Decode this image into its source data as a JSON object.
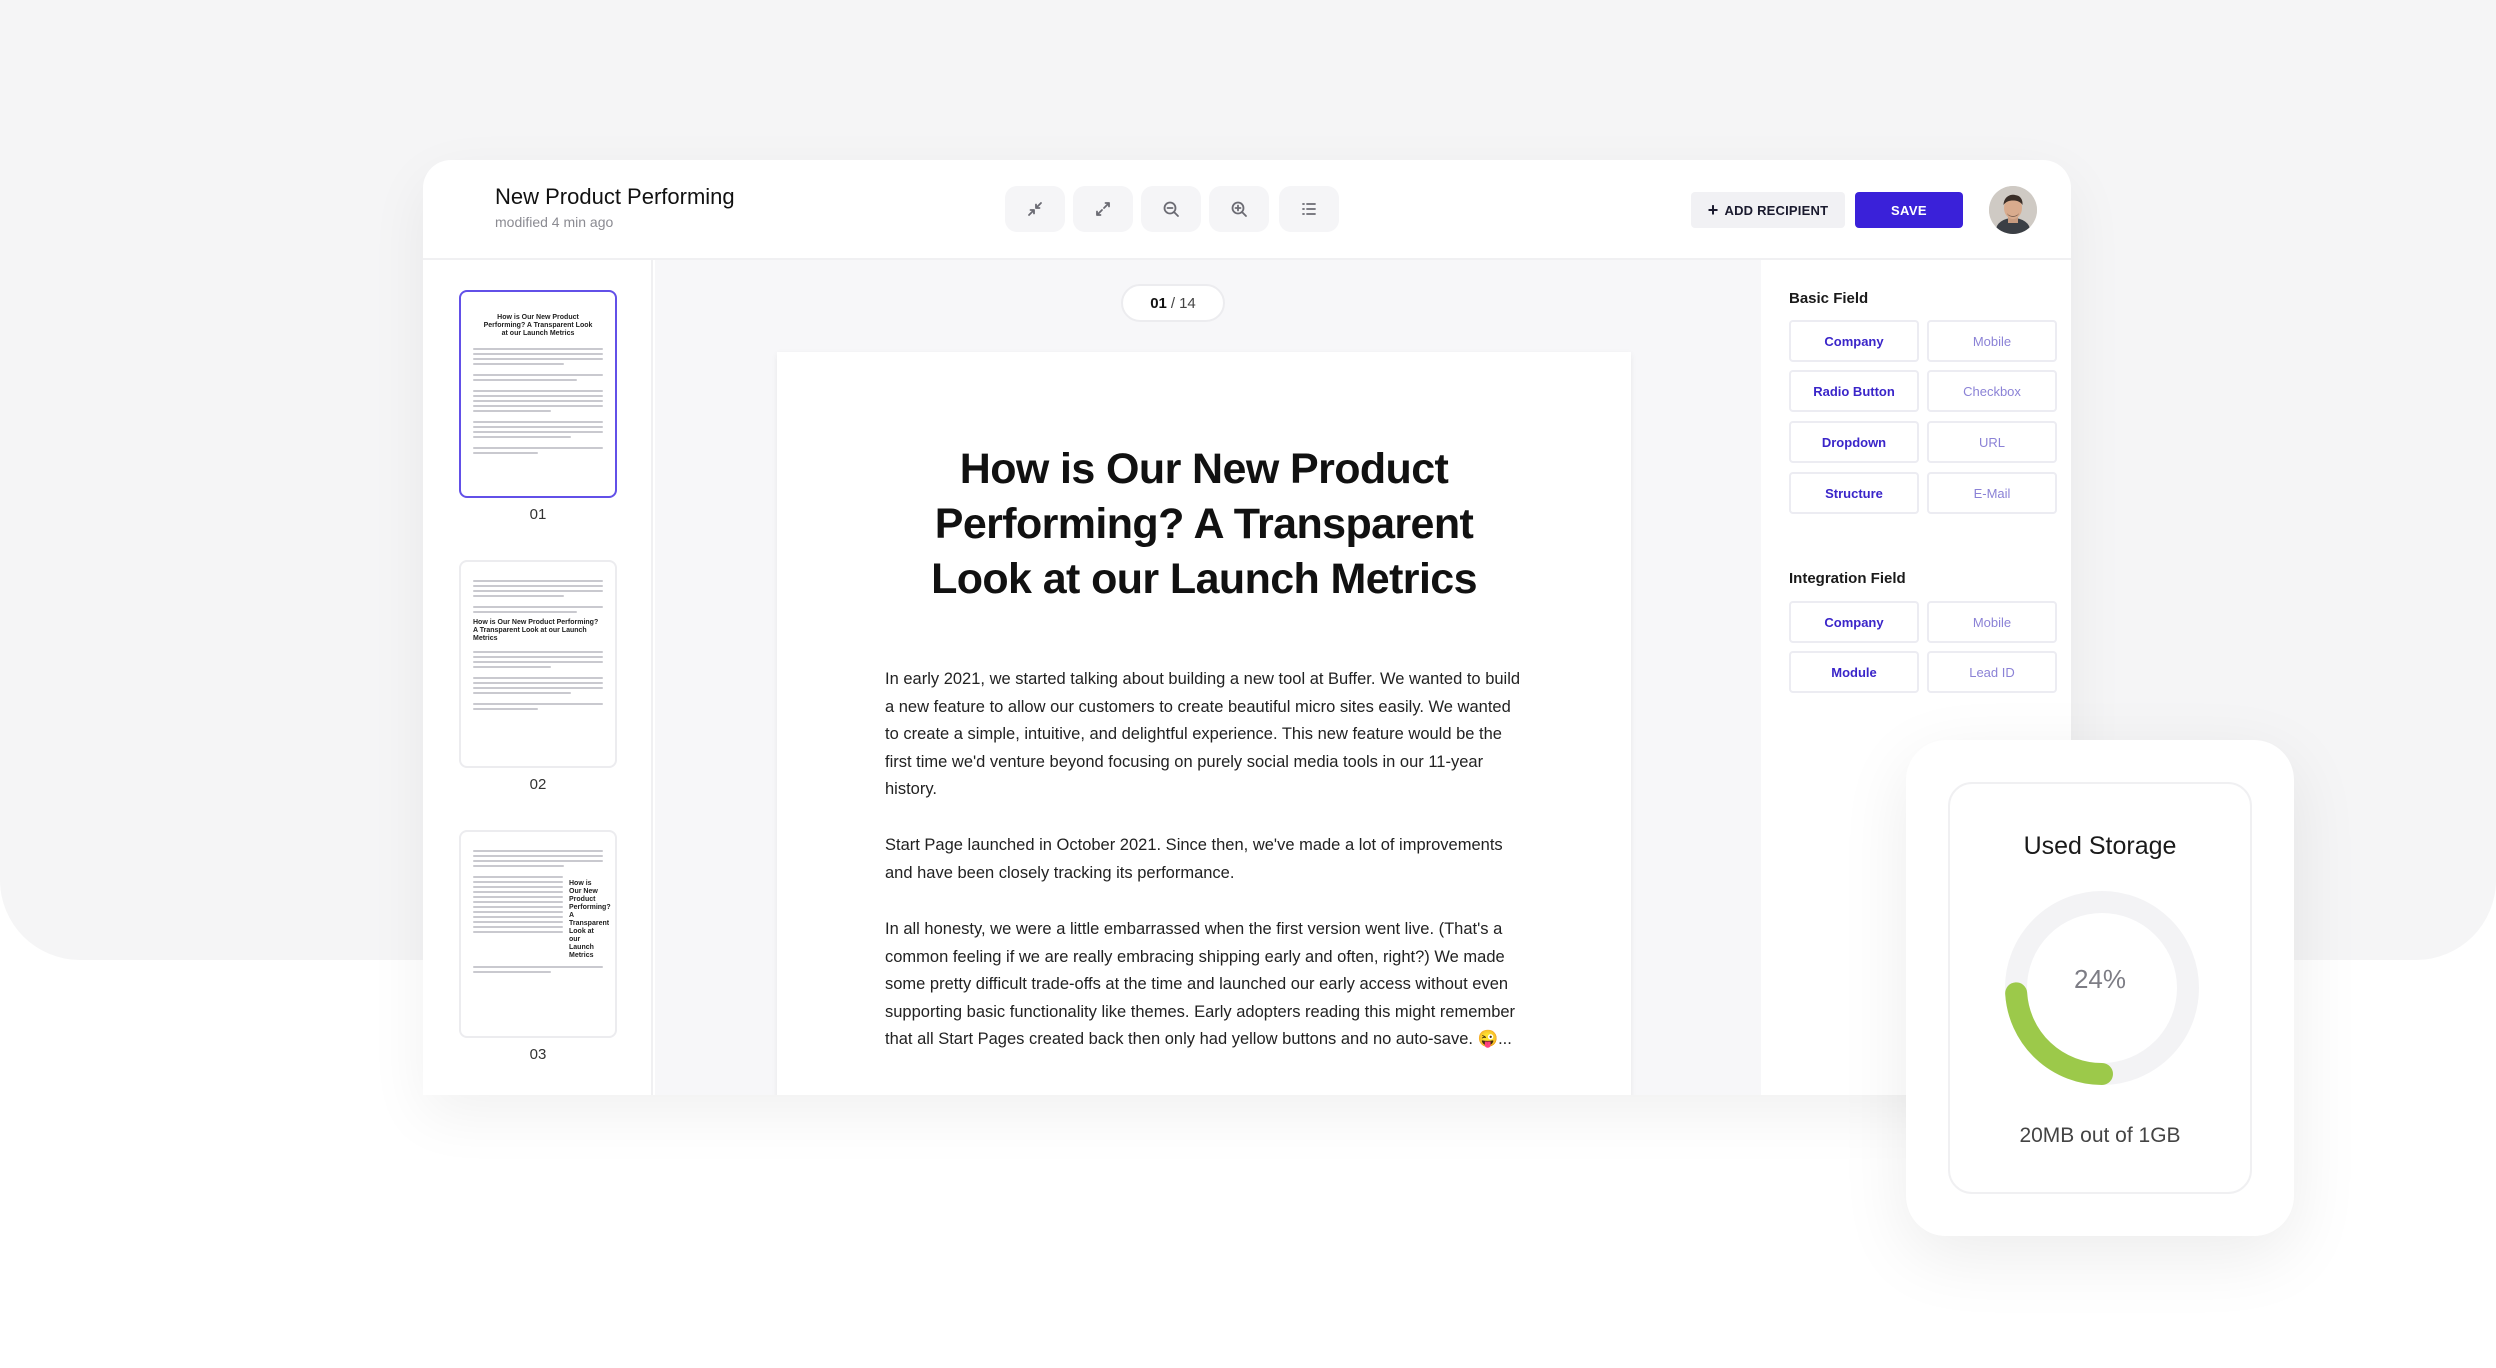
{
  "header": {
    "title": "New Product Performing",
    "subtitle": "modified 4 min ago",
    "tools": [
      "collapse-icon",
      "expand-icon",
      "zoom-out-icon",
      "zoom-in-icon",
      "list-icon"
    ],
    "add_recipient_label": "ADD RECIPIENT",
    "save_label": "SAVE"
  },
  "thumbnails": [
    {
      "number": "01",
      "heading": "How is Our New Product Performing? A Transparent Look at our Launch Metrics"
    },
    {
      "number": "02",
      "heading": "How is Our New Product Performing? A Transparent Look at our Launch Metrics"
    },
    {
      "number": "03",
      "heading": "How is Our New Product Performing? A Transparent Look at our Launch Metrics"
    }
  ],
  "pager": {
    "current": "01",
    "separator": "/",
    "total": "14"
  },
  "document": {
    "title": "How is Our New Product Performing? A Transparent Look at our Launch Metrics",
    "paragraphs": [
      "In early 2021, we started talking about building a new tool at Buffer. We wanted to build a new feature to allow our customers to create beautiful micro sites easily. We wanted to create a simple, intuitive, and delightful experience. This new feature would be the first time we'd venture beyond focusing on purely social media tools in our 11-year history.",
      "Start Page launched in October 2021. Since then, we've made a lot of improvements and have been closely tracking its performance.",
      "In all honesty, we were a little embarrassed when the first version went live. (That's a common feeling if we are really embracing shipping early and often, right?) We made some pretty difficult trade-offs at the time and launched our early access without even supporting basic functionality like themes. Early adopters reading this might remember that all Start Pages created back then only had yellow buttons and no auto-save. 😜..."
    ]
  },
  "basic_field": {
    "title": "Basic Field",
    "items": [
      "Company",
      "Mobile",
      "Radio Button",
      "Checkbox",
      "Dropdown",
      "URL",
      "Structure",
      "E-Mail"
    ]
  },
  "integration_field": {
    "title": "Integration Field",
    "items": [
      "Company",
      "Mobile",
      "Module",
      "Lead ID"
    ]
  },
  "storage": {
    "title": "Used Storage",
    "percent_label": "24%",
    "percent": 24,
    "usage": "20MB out of 1GB",
    "accent_color": "#9cc94a",
    "track_color": "#f3f3f5"
  },
  "colors": {
    "primary": "#3a21d9",
    "active_border": "#6250e8"
  }
}
